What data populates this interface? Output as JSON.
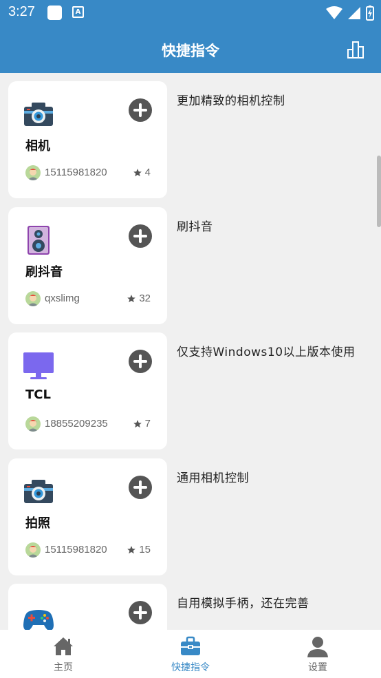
{
  "status_bar": {
    "time": "3:27",
    "badge_letter": "A"
  },
  "app_bar": {
    "title": "快捷指令",
    "chart_icon": "bar-chart-icon"
  },
  "shortcuts": [
    {
      "name": "相机",
      "icon": "camera-icon",
      "author": "15115981820",
      "stars": "4",
      "description": "更加精致的相机控制"
    },
    {
      "name": "刷抖音",
      "icon": "speaker-icon",
      "author": "qxslimg",
      "stars": "32",
      "description": "刷抖音"
    },
    {
      "name": "TCL",
      "icon": "monitor-icon",
      "author": "18855209235",
      "stars": "7",
      "description": "仅支持Windows10以上版本使用"
    },
    {
      "name": "拍照",
      "icon": "camera-icon",
      "author": "15115981820",
      "stars": "15",
      "description": "通用相机控制"
    },
    {
      "name": "",
      "icon": "gamepad-icon",
      "author": "",
      "stars": "",
      "description": "自用模拟手柄，还在完善"
    }
  ],
  "bottom_nav": [
    {
      "label": "主页",
      "icon": "home-icon"
    },
    {
      "label": "快捷指令",
      "icon": "toolbox-icon",
      "active": true
    },
    {
      "label": "设置",
      "icon": "person-icon"
    }
  ],
  "colors": {
    "primary": "#3889c6",
    "card": "#ffffff",
    "background": "#f0f0f0"
  }
}
